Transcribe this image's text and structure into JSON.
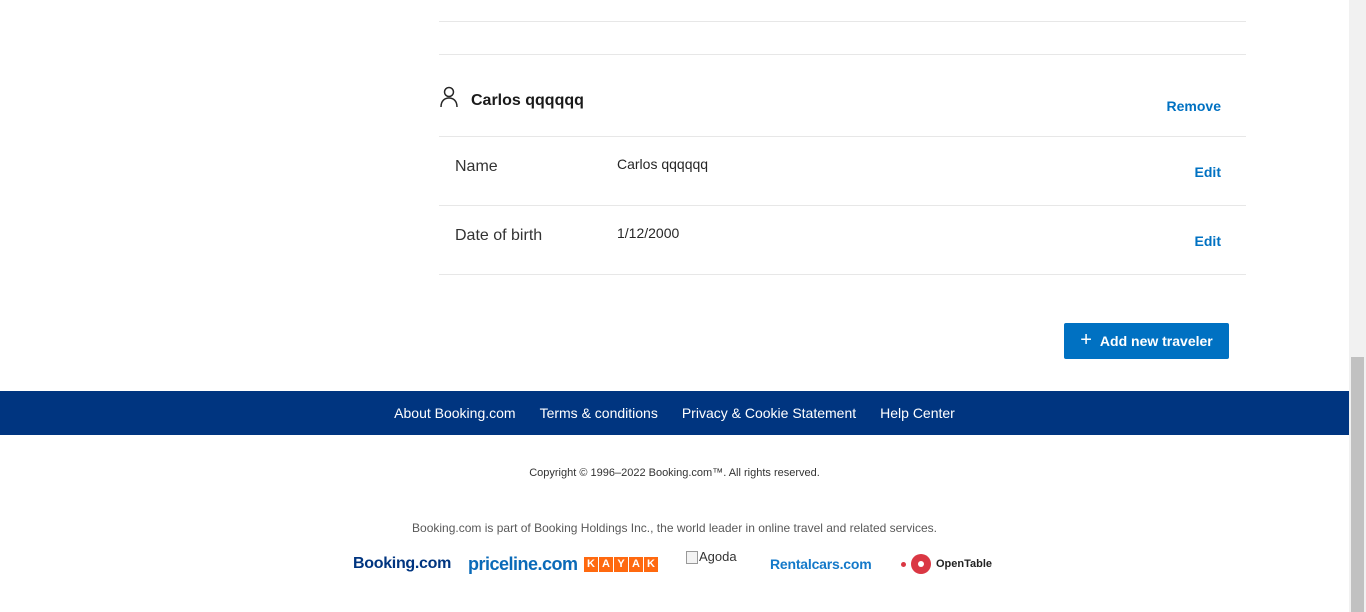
{
  "traveler": {
    "display_name": "Carlos qqqqqq",
    "remove_label": "Remove",
    "rows": [
      {
        "label": "Name",
        "value": "Carlos qqqqqq",
        "action": "Edit"
      },
      {
        "label": "Date of birth",
        "value": "1/12/2000",
        "action": "Edit"
      }
    ]
  },
  "add_traveler": {
    "label": "Add new traveler",
    "icon": "plus-icon"
  },
  "footer": {
    "links": [
      "About Booking.com",
      "Terms & conditions",
      "Privacy & Cookie Statement",
      "Help Center"
    ],
    "copyright": "Copyright © 1996–2022 Booking.com™. All rights reserved.",
    "holdings": "Booking.com is part of Booking Holdings Inc., the world leader in online travel and related services.",
    "brands": {
      "booking": "Booking.com",
      "priceline": "priceline.com",
      "kayak": "KAYAK",
      "agoda": "Agoda",
      "rentalcars": "Rentalcars.com",
      "opentable": "OpenTable"
    }
  },
  "colors": {
    "link": "#0071c2",
    "footer_bar": "#003580",
    "button": "#0071c2"
  }
}
